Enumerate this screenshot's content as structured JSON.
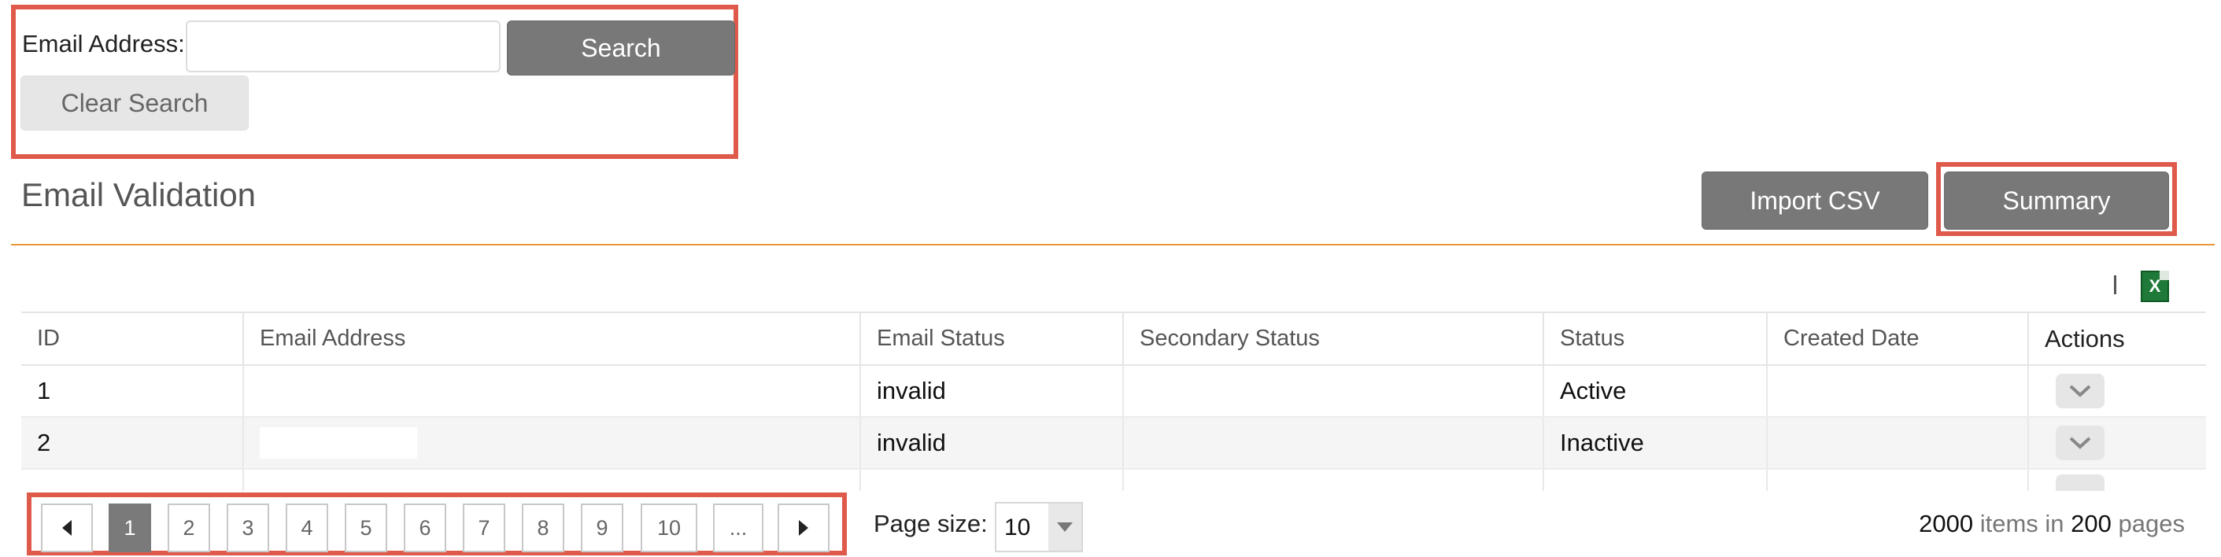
{
  "search": {
    "email_label": "Email Address:",
    "email_value": "",
    "email_placeholder": "",
    "search_label": "Search",
    "clear_label": "Clear Search"
  },
  "header": {
    "title": "Email Validation",
    "import_label": "Import CSV",
    "summary_label": "Summary"
  },
  "toolbar": {
    "separator_icon": "separator-icon",
    "export_icon": "excel-export-icon"
  },
  "table": {
    "columns": [
      "ID",
      "Email Address",
      "Email Status",
      "Secondary Status",
      "Status",
      "Created Date",
      "Actions"
    ],
    "rows": [
      {
        "id": "1",
        "email": "",
        "email_status": "invalid",
        "secondary_status": "",
        "status": "Active",
        "created": ""
      },
      {
        "id": "2",
        "email": "",
        "email_status": "invalid",
        "secondary_status": "",
        "status": "Inactive",
        "created": ""
      }
    ],
    "action_icon": "chevron-down-icon"
  },
  "pager": {
    "pages": [
      "1",
      "2",
      "3",
      "4",
      "5",
      "6",
      "7",
      "8",
      "9",
      "10",
      "..."
    ],
    "active_page": "1",
    "prev_icon": "triangle-left-icon",
    "next_icon": "triangle-right-icon",
    "page_size_label": "Page size:",
    "page_size_value": "10",
    "total_items": "2000",
    "items_in_text": "items in",
    "total_pages": "200",
    "pages_text": "pages"
  },
  "colors": {
    "highlight": "#e05a4c",
    "accent_rule": "#e8963a",
    "button_dark": "#787878"
  }
}
